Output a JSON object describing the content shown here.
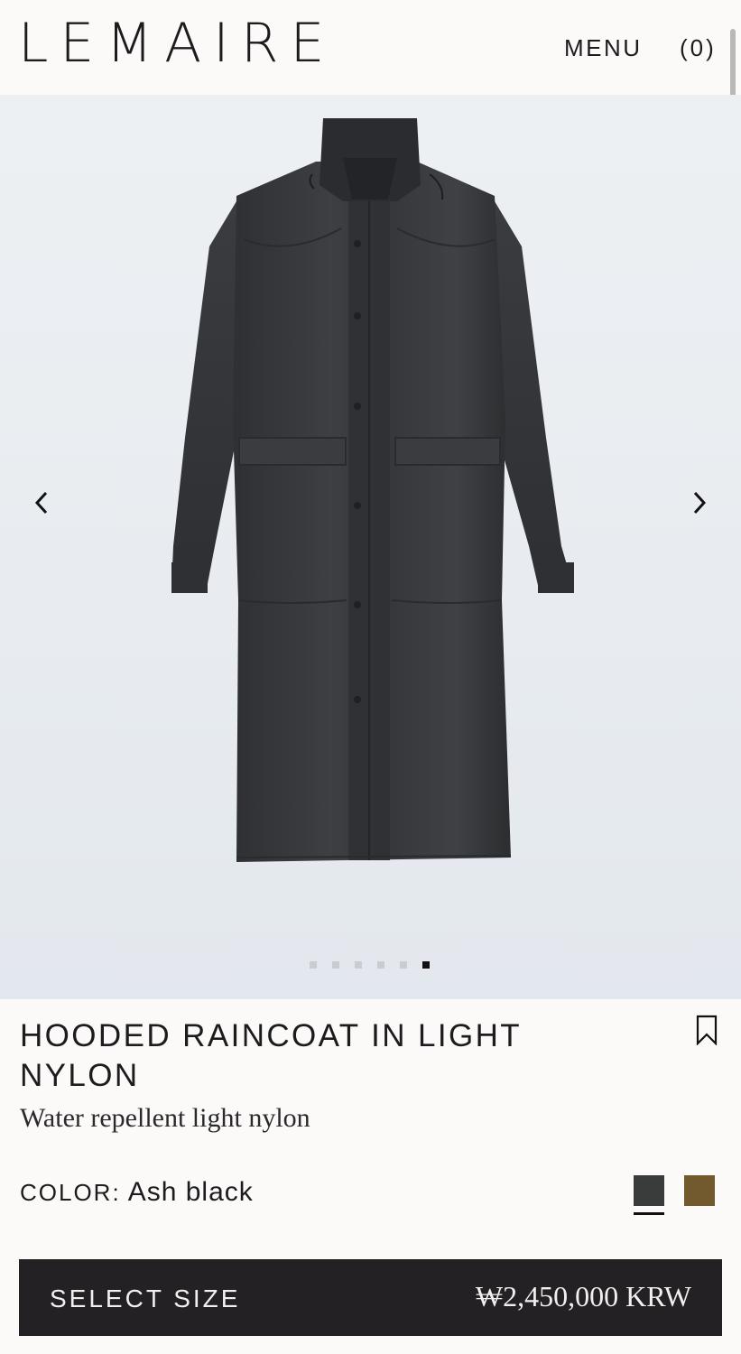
{
  "header": {
    "logo": "LEMAIRE",
    "menu_label": "MENU",
    "cart_label": "(0)"
  },
  "gallery": {
    "prev_icon": "chevron-left-icon",
    "next_icon": "chevron-right-icon",
    "slide_count": 6,
    "active_slide": 6
  },
  "product": {
    "title": "HOODED RAINCOAT IN LIGHT NYLON",
    "subtitle": "Water repellent light nylon",
    "color_label": "COLOR:",
    "color_value": "Ash black",
    "swatches": [
      {
        "name": "Ash black",
        "hex": "#3a3c3c",
        "selected": true
      },
      {
        "name": "brown",
        "hex": "#73592e",
        "selected": false
      }
    ]
  },
  "purchase": {
    "select_size_label": "SELECT SIZE",
    "price": "₩2,450,000 KRW"
  },
  "colors": {
    "background": "#fbfaf8",
    "gallery_bg": "#e8ecf0",
    "bar_bg": "#232124",
    "text": "#1c1b1d"
  }
}
